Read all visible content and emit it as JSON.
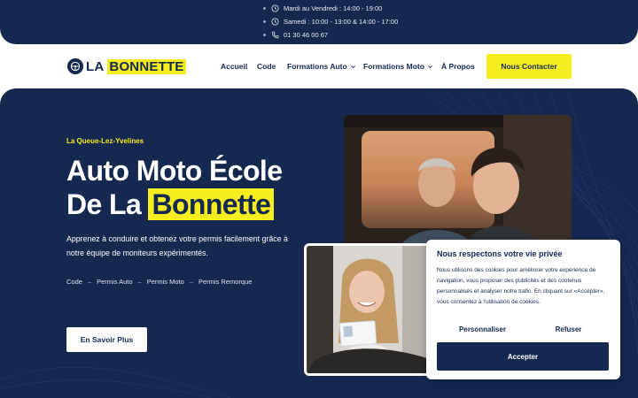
{
  "topbar": {
    "hours_weekday": "Mardi au Vendredi : 14:00 - 19:00",
    "hours_saturday": "Samedi : 10:00 - 13:00 & 14:00 - 17:00",
    "phone": "01 30 46 00 67"
  },
  "brand": {
    "name_part1": "LA",
    "name_part2": "BONNETTE",
    "accent_color": "#f6ed1f",
    "primary_color": "#142850"
  },
  "nav": {
    "items": [
      {
        "label": "Accueil"
      },
      {
        "label": "Code"
      },
      {
        "label": "Formations Auto",
        "icon": "chevron-down-icon"
      },
      {
        "label": "Formations Moto",
        "icon": "chevron-down-icon"
      },
      {
        "label": "À Propos"
      }
    ],
    "cta_label": "Nous Contacter"
  },
  "hero": {
    "location": "La Queue-Lez-Yvelines",
    "title_line1": "Auto Moto École",
    "title_line2_prefix": "De La",
    "title_line2_highlight": "Bonnette",
    "description": "Apprenez à conduire et obtenez votre permis facilement grâce à notre équipe de moniteurs expérimentés.",
    "tags": [
      "Code",
      "Permis Auto",
      "Permis Moto",
      "Permis Remorque"
    ],
    "tag_separator": "–",
    "button_label": "En Savoir Plus"
  },
  "cookie_banner": {
    "title": "Nous respectons votre vie privée",
    "body": "Nous utilisons des cookies pour améliorer votre expérience de navigation, vous proposer des publicités et des contenus personnalisés et analyser notre trafic. En cliquant sur «Accepter», vous consentez à l'utilisation de cookies.",
    "customize_label": "Personnaliser",
    "refuse_label": "Refuser",
    "accept_label": "Accepter"
  }
}
